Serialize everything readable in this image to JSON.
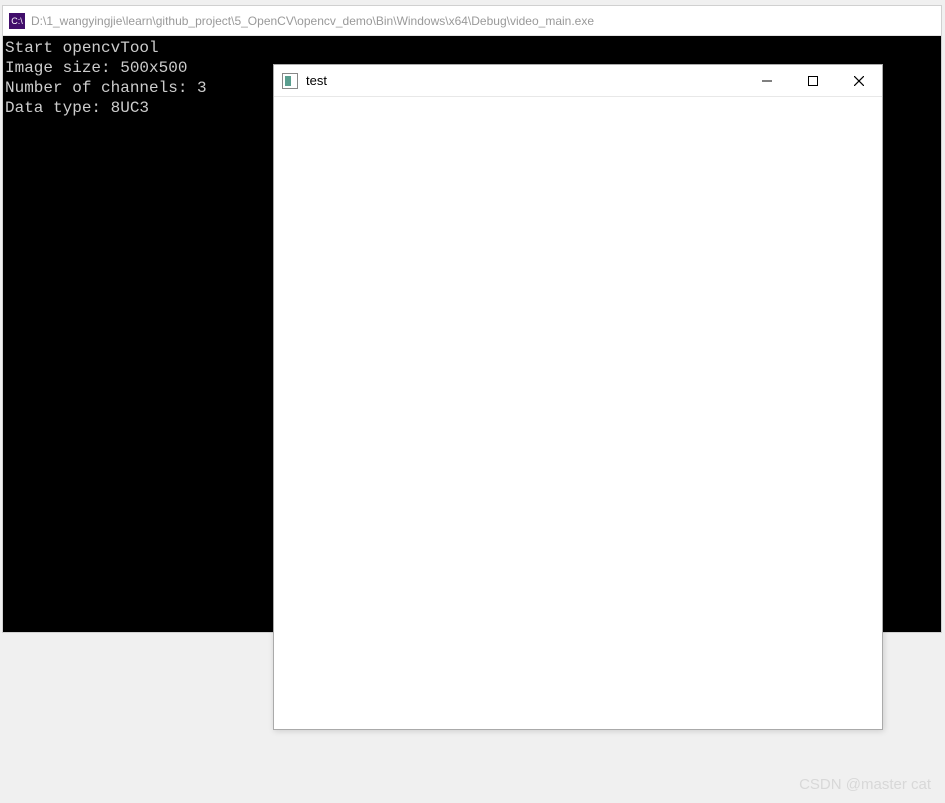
{
  "console": {
    "icon_text": "C:\\",
    "title": "D:\\1_wangyingjie\\learn\\github_project\\5_OpenCV\\opencv_demo\\Bin\\Windows\\x64\\Debug\\video_main.exe",
    "lines": [
      "Start opencvTool",
      "Image size: 500x500",
      "Number of channels: 3",
      "Data type: 8UC3"
    ]
  },
  "image_window": {
    "title": "test"
  },
  "watermark": "CSDN @master cat"
}
